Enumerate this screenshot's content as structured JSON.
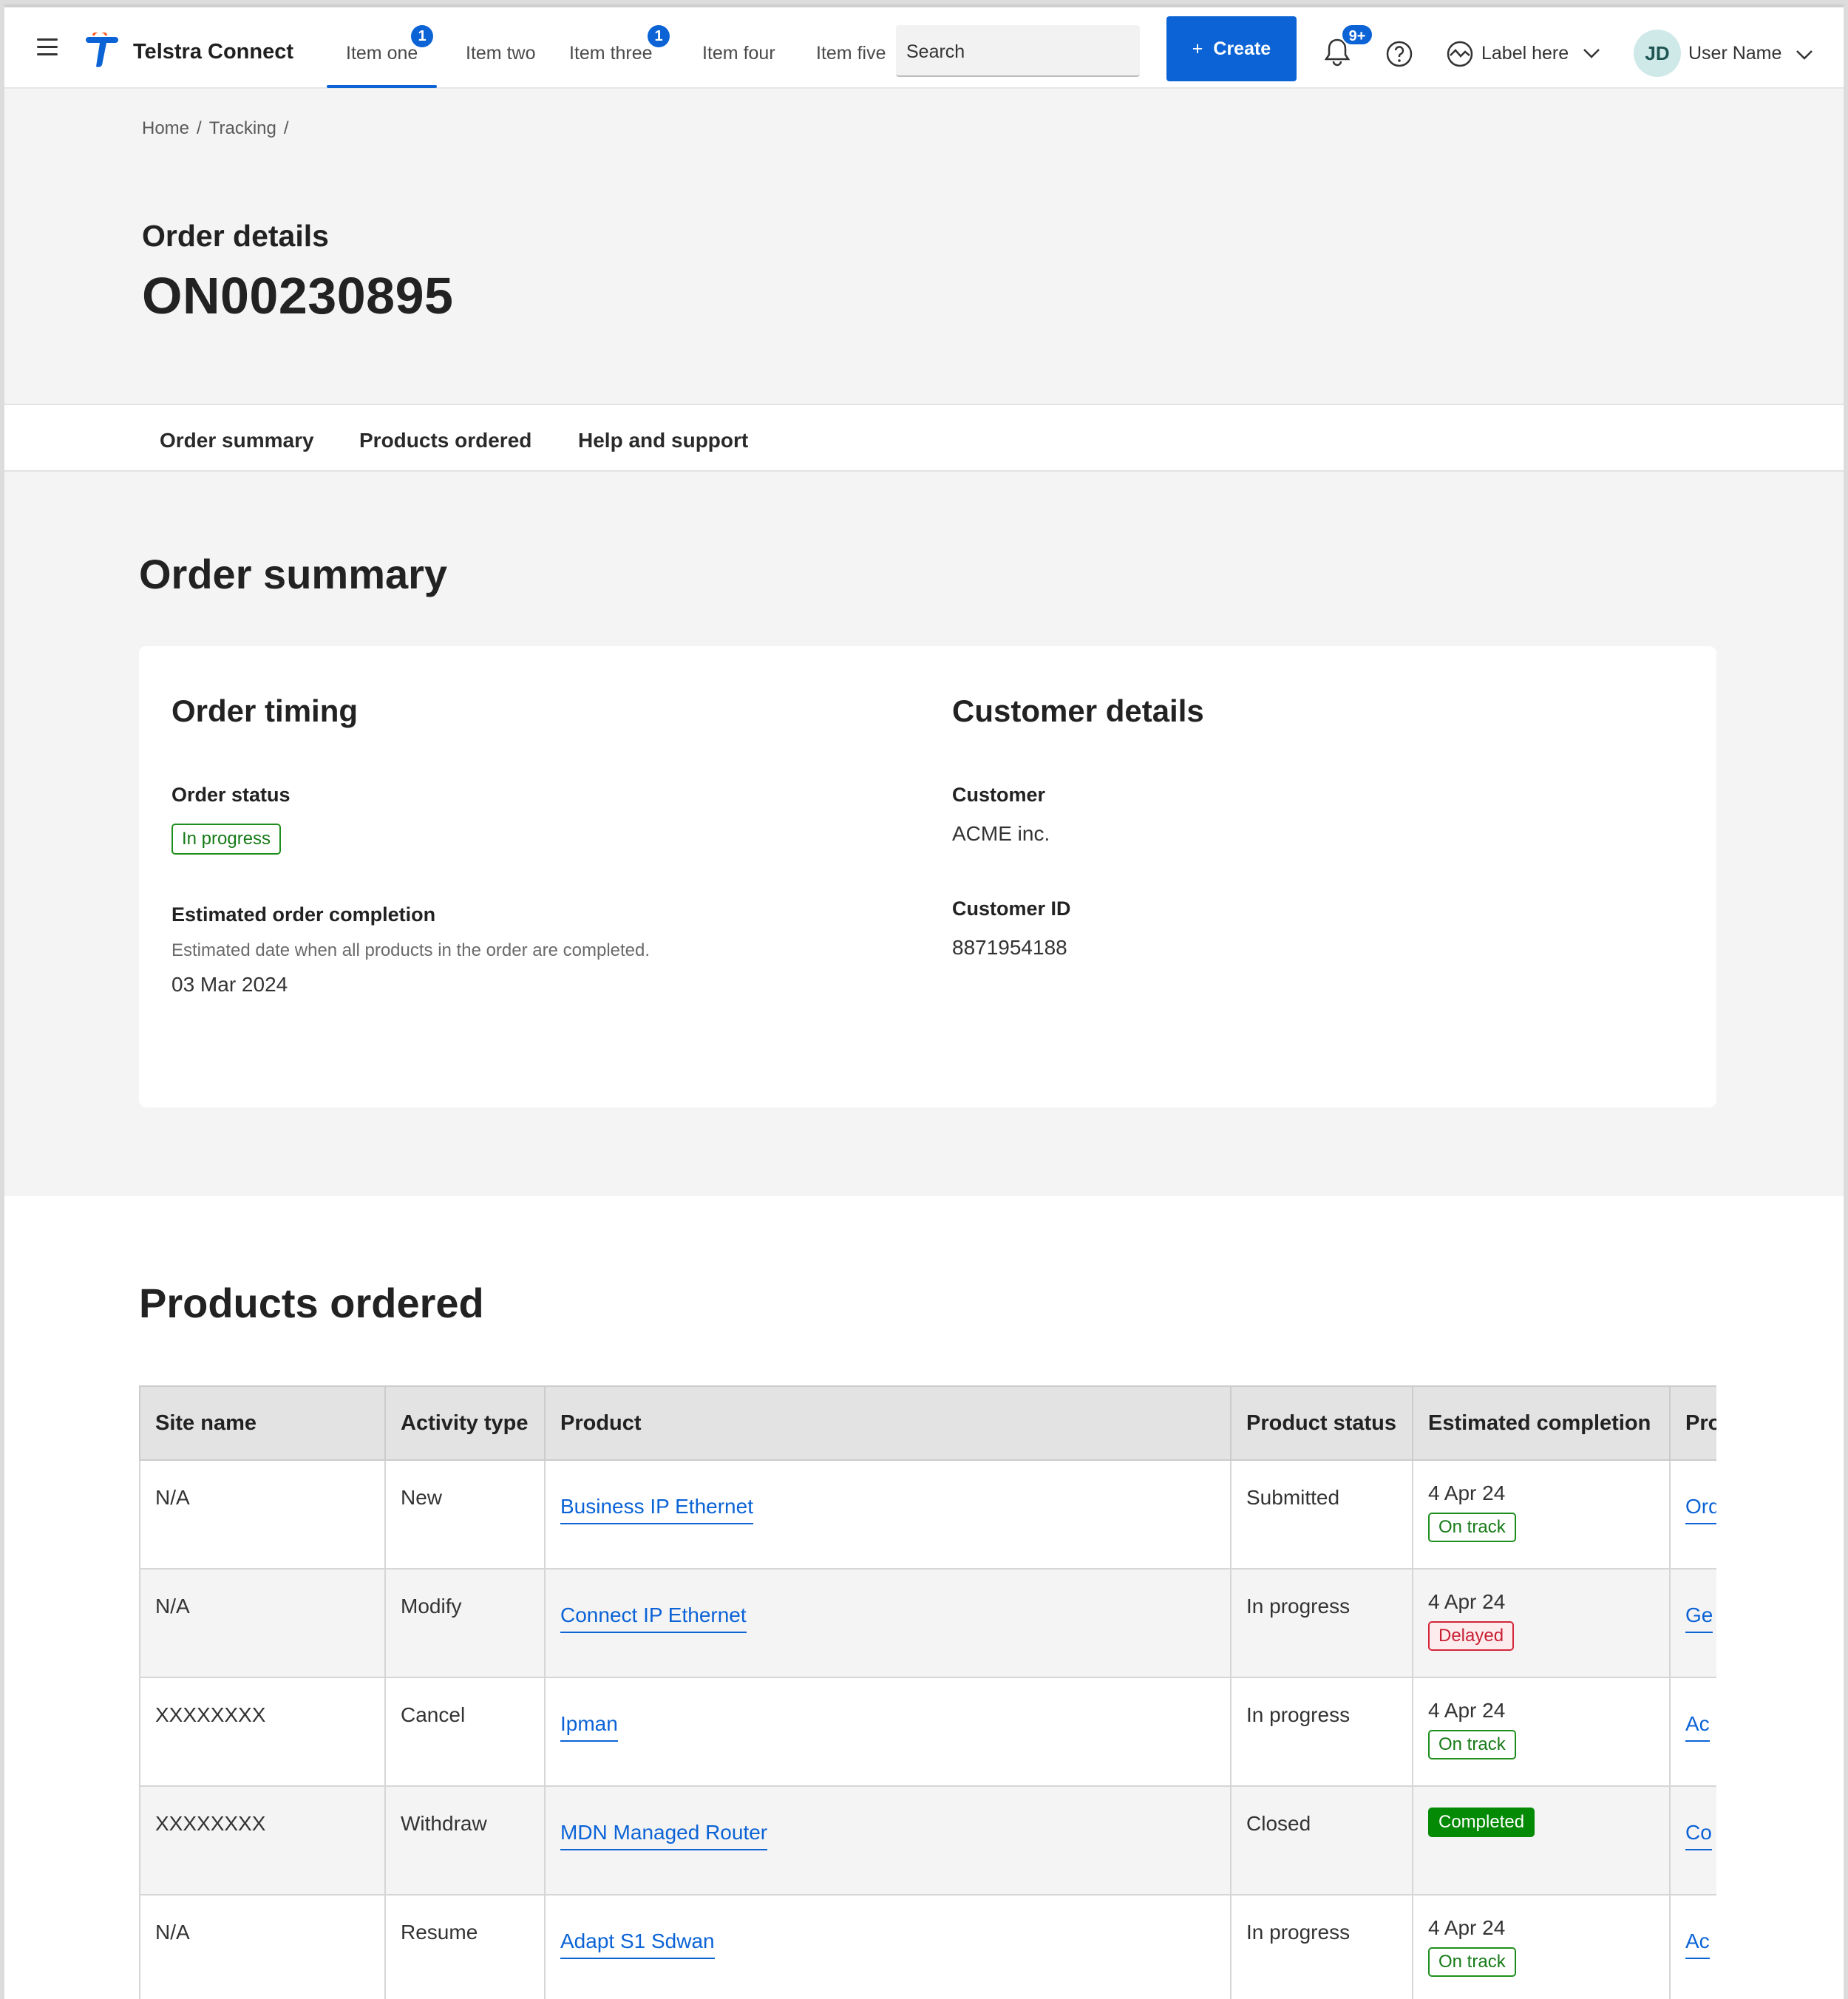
{
  "colors": {
    "accent": "#0b63d6",
    "success": "#1e8f1e",
    "danger": "#d3263a",
    "completed": "#058a05"
  },
  "topnav": {
    "brand": "Telstra Connect",
    "items": [
      {
        "label": "Item one",
        "badge": "1",
        "active": true
      },
      {
        "label": "Item two"
      },
      {
        "label": "Item three",
        "badge": "1"
      },
      {
        "label": "Item four"
      },
      {
        "label": "Item five"
      }
    ],
    "search_placeholder": "Search",
    "create_label": "Create",
    "notifications_badge": "9+",
    "icons": [
      "hamburger-icon",
      "telstra-logo",
      "bell-icon",
      "help-icon",
      "trend-icon",
      "chevron-down-icon"
    ],
    "label_here": "Label here",
    "user_initials": "JD",
    "user_name": "User Name"
  },
  "breadcrumb": {
    "home": "Home",
    "tracking": "Tracking",
    "sep": "/"
  },
  "header": {
    "label": "Order details",
    "order_number": "ON00230895"
  },
  "tabs": [
    "Order summary",
    "Products ordered",
    "Help and support"
  ],
  "order_summary": {
    "title": "Order summary",
    "timing": {
      "heading": "Order timing",
      "status_label": "Order status",
      "status_value": "In progress",
      "completion_label": "Estimated order completion",
      "completion_help": "Estimated date when all products in the order are completed.",
      "completion_value": "03 Mar 2024"
    },
    "customer": {
      "heading": "Customer details",
      "customer_label": "Customer",
      "customer_value": "ACME inc.",
      "id_label": "Customer ID",
      "id_value": "8871954188"
    }
  },
  "products": {
    "title": "Products ordered",
    "columns": [
      "Site name",
      "Activity type",
      "Product",
      "Product status",
      "Estimated completion",
      "Pro"
    ],
    "rows": [
      {
        "site": "N/A",
        "activity": "New",
        "product": "Business IP Ethernet",
        "status": "Submitted",
        "est_date": "4 Apr 24",
        "est_flag": "On track",
        "flag_kind": "green",
        "next": "Ord"
      },
      {
        "site": "N/A",
        "activity": "Modify",
        "product": "Connect IP Ethernet",
        "status": "In progress",
        "est_date": "4 Apr 24",
        "est_flag": "Delayed",
        "flag_kind": "red",
        "next": "Ge"
      },
      {
        "site": "XXXXXXXX",
        "activity": "Cancel",
        "product": "Ipman",
        "status": "In progress",
        "est_date": "4 Apr 24",
        "est_flag": "On track",
        "flag_kind": "green",
        "next": "Ac"
      },
      {
        "site": "XXXXXXXX",
        "activity": "Withdraw",
        "product": "MDN Managed Router",
        "status": "Closed",
        "est_date": "",
        "est_flag": "Completed",
        "flag_kind": "solid",
        "next": "Co"
      },
      {
        "site": "N/A",
        "activity": "Resume",
        "product": "Adapt S1 Sdwan",
        "status": "In progress",
        "est_date": "4 Apr 24",
        "est_flag": "On track",
        "flag_kind": "green",
        "next": "Ac"
      }
    ]
  }
}
